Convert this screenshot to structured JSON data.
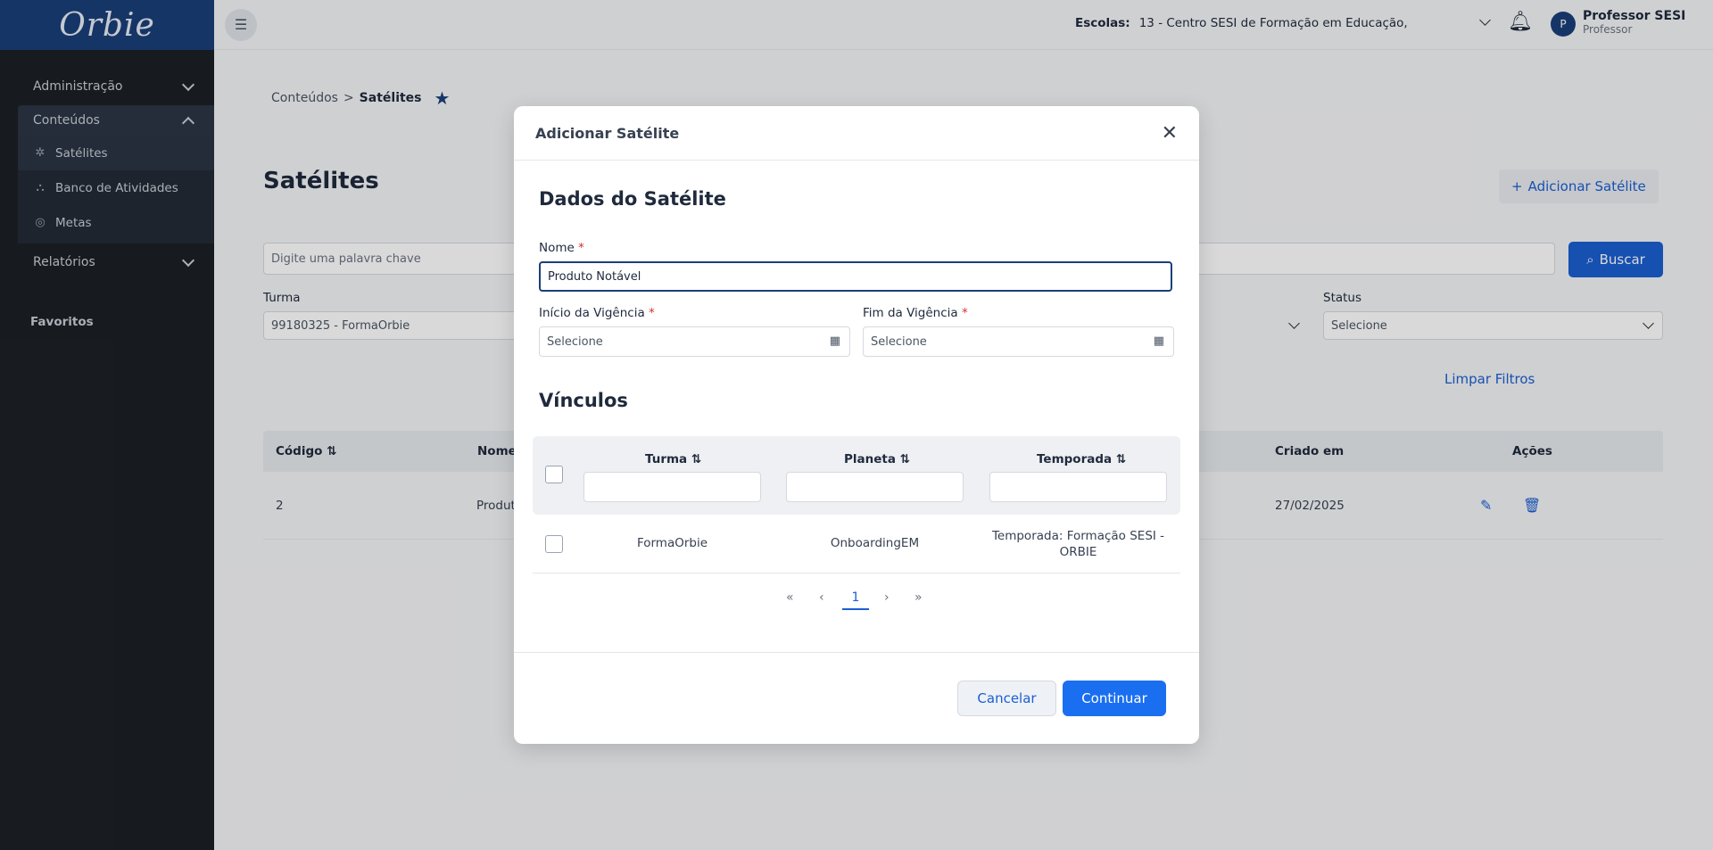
{
  "app": {
    "logo": "Orbie"
  },
  "sidebar": {
    "groups": [
      {
        "label": "Administração"
      },
      {
        "label": "Conteúdos"
      },
      {
        "label": "Relatórios"
      }
    ],
    "sub_items": [
      {
        "label": "Satélites"
      },
      {
        "label": "Banco de Atividades"
      },
      {
        "label": "Metas"
      }
    ],
    "favoritos": "Favoritos"
  },
  "topbar": {
    "school_label": "Escolas:",
    "school_value": "13 - Centro SESI de Formação em Educação,",
    "avatar_letter": "P",
    "user_name": "Professor SESI",
    "user_role": "Professor"
  },
  "page": {
    "breadcrumb_parent": "Conteúdos",
    "breadcrumb_sep": ">",
    "breadcrumb_current": "Satélites",
    "title": "Satélites",
    "add_button": "Adicionar Satélite",
    "search_placeholder": "Digite uma palavra chave",
    "search_button": "Buscar",
    "filters": {
      "turma_label": "Turma",
      "turma_value": "99180325 - FormaOrbie",
      "status_label": "Status",
      "status_value": "Selecione"
    },
    "clear_filters": "Limpar Filtros",
    "table": {
      "headers": {
        "codigo": "Código",
        "nome": "Nome",
        "criado": "Criado em",
        "acoes": "Ações"
      },
      "rows": [
        {
          "codigo": "2",
          "nome": "Produt",
          "criado": "27/02/2025"
        }
      ]
    }
  },
  "modal": {
    "title": "Adicionar Satélite",
    "section_data": "Dados do Satélite",
    "nome_label": "Nome",
    "nome_value": "Produto Notável",
    "inicio_label": "Início da Vigência",
    "inicio_placeholder": "Selecione",
    "fim_label": "Fim da Vigência",
    "fim_placeholder": "Selecione",
    "section_links": "Vínculos",
    "grid": {
      "headers": {
        "turma": "Turma",
        "planeta": "Planeta",
        "temporada": "Temporada"
      },
      "rows": [
        {
          "turma": "FormaOrbie",
          "planeta": "OnboardingEM",
          "temporada": "Temporada: Formação SESI - ORBIE"
        }
      ]
    },
    "pager": {
      "first": "«",
      "prev": "‹",
      "current": "1",
      "next": "›",
      "last": "»"
    },
    "cancel": "Cancelar",
    "continue": "Continuar"
  },
  "colors": {
    "accent": "#1b5fd1",
    "nav_bg": "#1c2026",
    "logo_bg": "#1b3f79"
  }
}
